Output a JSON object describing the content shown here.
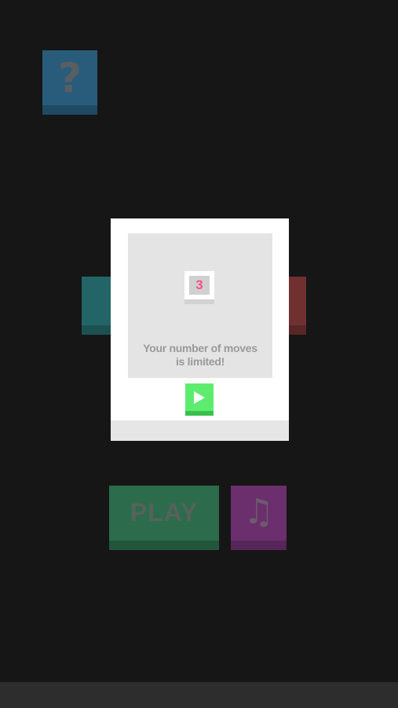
{
  "background": {
    "help_tile": {
      "icon": "question-mark-icon",
      "glyph": "?",
      "color": "#285c7a"
    },
    "left_tile": {
      "color": "#236566"
    },
    "right_tile": {
      "color": "#703030"
    },
    "play_button": {
      "label": "PLAY",
      "color": "#2c6b4b"
    },
    "music_button": {
      "icon": "music-note-icon",
      "glyph": "♫",
      "color": "#6a2f6c"
    }
  },
  "tutorial_dialog": {
    "moves_counter": "3",
    "message": "Your number of moves\nis limited!",
    "next_button_icon": "play-triangle-icon",
    "accent_colors": {
      "counter": "#ff4f8a",
      "next_button": "#5eec6e"
    }
  }
}
